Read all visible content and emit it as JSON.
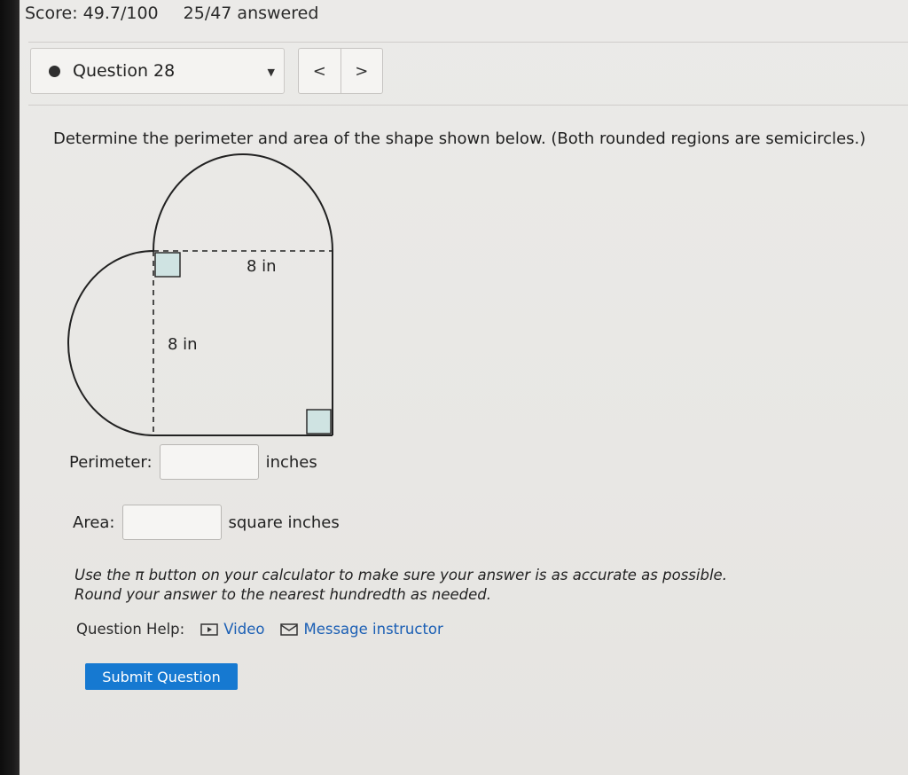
{
  "header": {
    "score": "Score: 49.7/100",
    "answered": "25/47 answered"
  },
  "question_selector": {
    "label": "Question 28"
  },
  "nav": {
    "prev": "<",
    "next": ">"
  },
  "prompt": "Determine the perimeter and area of the shape shown below. (Both rounded regions are semicircles.)",
  "figure": {
    "top_dimension": "8 in",
    "side_dimension": "8 in"
  },
  "perimeter": {
    "label": "Perimeter:",
    "value": "",
    "unit": "inches"
  },
  "area": {
    "label": "Area:",
    "value": "",
    "unit": "square inches"
  },
  "instructions": {
    "line1": "Use the π button on your calculator to make sure your answer is as accurate as possible.",
    "line2": "Round your answer to the nearest hundredth as needed."
  },
  "help": {
    "label": "Question Help:",
    "video": "Video",
    "message": "Message instructor"
  },
  "submit": "Submit Question",
  "colors": {
    "accent": "#1679d1",
    "link": "#1b5fb4",
    "right_angle_fill": "#cfe3e2"
  }
}
